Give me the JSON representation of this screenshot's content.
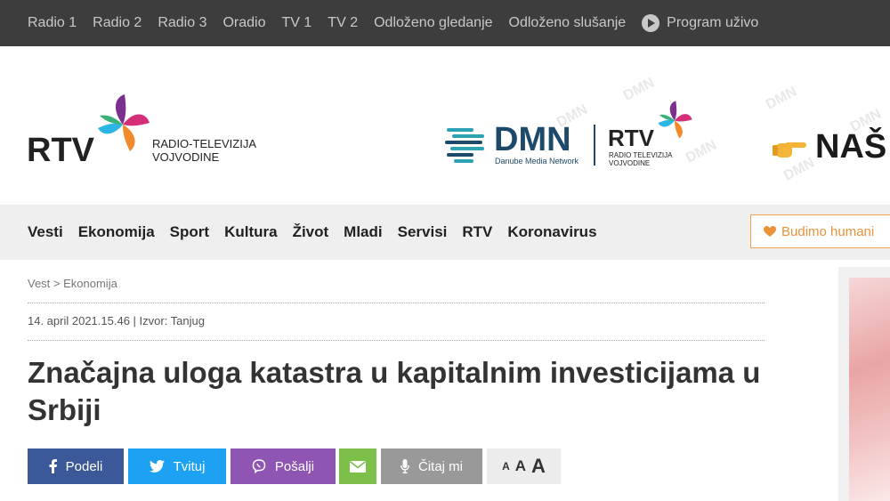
{
  "topbar": {
    "links": [
      "Radio 1",
      "Radio 2",
      "Radio 3",
      "Oradio",
      "TV 1",
      "TV 2",
      "Odloženo gledanje",
      "Odloženo slušanje"
    ],
    "live": "Program uživo"
  },
  "logo": {
    "name": "RTV",
    "sub1": "RADIO-TELEVIZIJA",
    "sub2": "VOJVODINE"
  },
  "banner": {
    "dmn": "DMN",
    "dmn_sub": "Danube Media Network",
    "rtv": "RTV",
    "rtv_sub1": "RADIO TELEVIZIJA",
    "rtv_sub2": "VOJVODINE",
    "nas": "NAŠ",
    "watermark": "DMN"
  },
  "nav": {
    "items": [
      "Vesti",
      "Ekonomija",
      "Sport",
      "Kultura",
      "Život",
      "Mladi",
      "Servisi",
      "RTV",
      "Koronavirus"
    ],
    "humani": "Budimo humani"
  },
  "article": {
    "breadcrumb": "Vest > Ekonomija",
    "meta": "14. april 2021.15.46 | Izvor: Tanjug",
    "title": "Značajna uloga katastra u kapitalnim investicijama u Srbiji"
  },
  "share": {
    "facebook": "Podeli",
    "twitter": "Tvituj",
    "viber": "Pošalji",
    "read": "Čitaj mi",
    "font_sizes": [
      "A",
      "A",
      "A"
    ]
  },
  "colors": {
    "facebook": "#3b5998",
    "twitter": "#1da1f2",
    "viber": "#8e55b3",
    "email": "#7cc04a",
    "read": "#999999",
    "accent": "#e8923a"
  }
}
